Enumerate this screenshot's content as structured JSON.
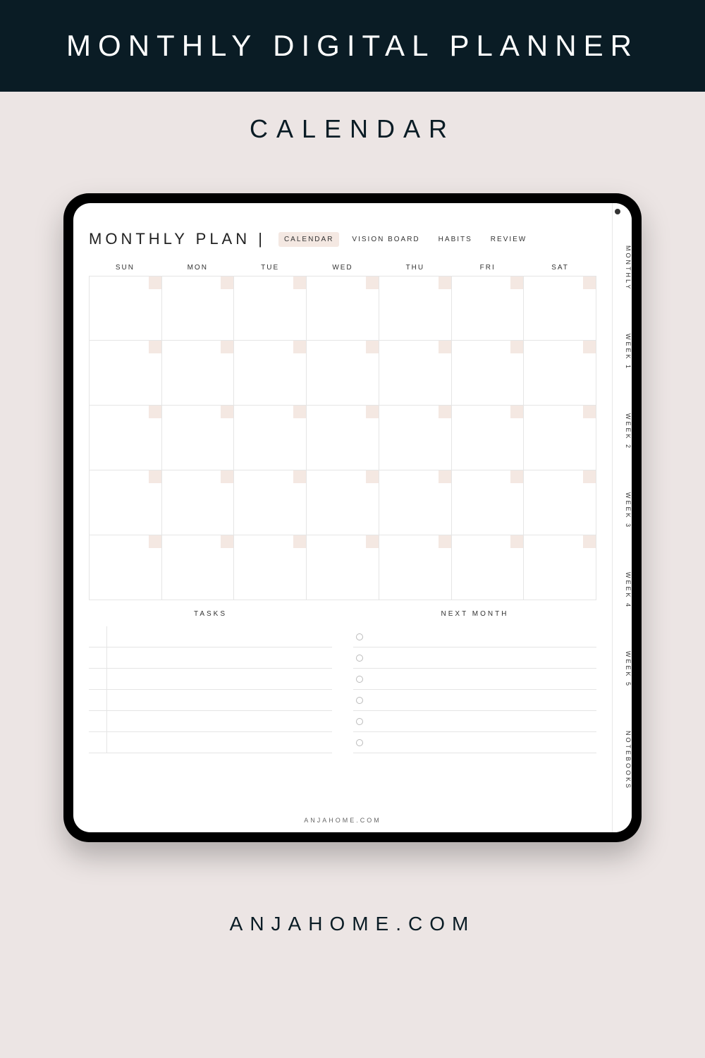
{
  "banner": {
    "title": "MONTHLY DIGITAL PLANNER"
  },
  "sub_heading": "CALENDAR",
  "page": {
    "title": "MONTHLY PLAN |",
    "nav_tabs": [
      {
        "label": "CALENDAR",
        "active": true
      },
      {
        "label": "VISION BOARD",
        "active": false
      },
      {
        "label": "HABITS",
        "active": false
      },
      {
        "label": "REVIEW",
        "active": false
      }
    ],
    "weekdays": [
      "SUN",
      "MON",
      "TUE",
      "WED",
      "THU",
      "FRI",
      "SAT"
    ],
    "calendar": {
      "rows": 5,
      "cols": 7
    },
    "tasks_label": "TASKS",
    "tasks_rows": 6,
    "next_month_label": "NEXT MONTH",
    "next_month_rows": 6,
    "footer": "ANJAHOME.COM"
  },
  "side_tabs": [
    "MONTHLY",
    "WEEK 1",
    "WEEK 2",
    "WEEK 3",
    "WEEK 4",
    "WEEK 5",
    "NOTEBOOKS"
  ],
  "brand": "ANJAHOME.COM"
}
